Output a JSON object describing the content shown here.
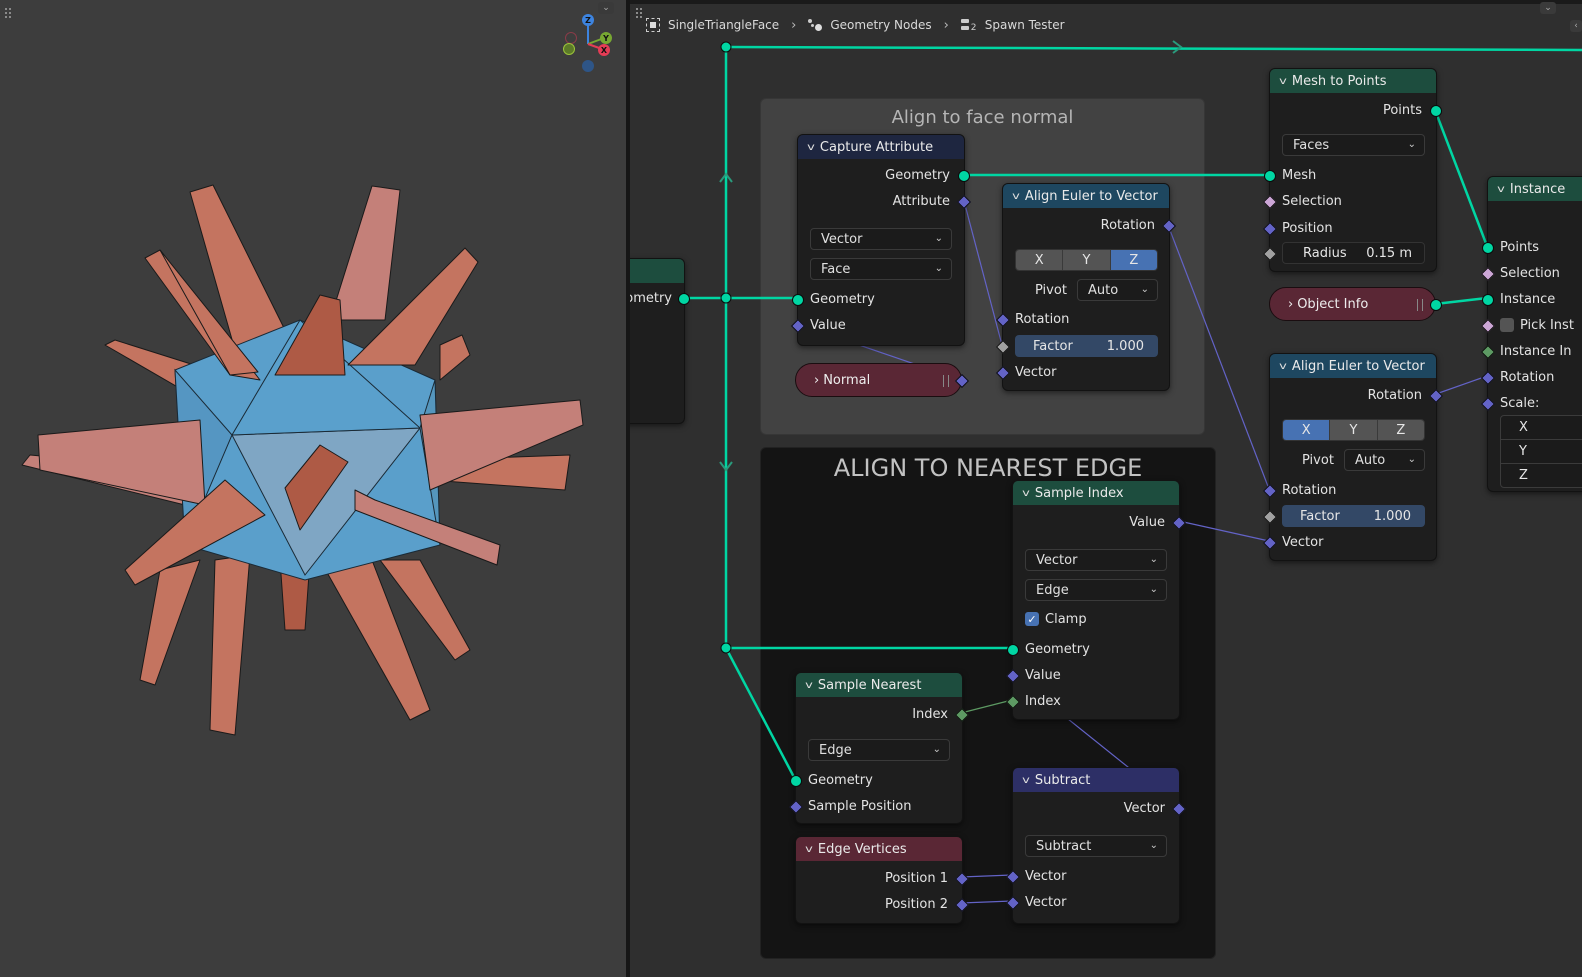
{
  "viewport": {
    "gizmo": {
      "z_label": "Z",
      "y_label": "Y",
      "x_label": "X"
    },
    "colors": {
      "background": "#3d3d3d",
      "mesh": "#5a9fcb",
      "instances": "#c47460"
    }
  },
  "node_editor": {
    "breadcrumb": [
      {
        "icon": "object-icon",
        "label": "SingleTriangleFace"
      },
      {
        "icon": "geometry-nodes-icon",
        "label": "Geometry Nodes"
      },
      {
        "icon": "node-tree-icon",
        "label": "Spawn Tester",
        "badge": "2"
      }
    ],
    "frames": {
      "align_face": {
        "title": "Align to face normal"
      },
      "align_edge": {
        "title": "ALIGN TO NEAREST EDGE"
      }
    },
    "nodes": {
      "group_input": {
        "output": "Geometry",
        "output_visible": "ometry"
      },
      "capture_attribute": {
        "title": "Capture Attribute",
        "outputs": [
          "Geometry",
          "Attribute"
        ],
        "data_type": "Vector",
        "domain": "Face",
        "inputs": [
          "Geometry",
          "Value"
        ]
      },
      "normal": {
        "title": "Normal"
      },
      "align_euler_1": {
        "title": "Align Euler to Vector",
        "output": "Rotation",
        "axis": [
          "X",
          "Y",
          "Z"
        ],
        "axis_selected": "Z",
        "pivot_label": "Pivot",
        "pivot": "Auto",
        "inputs": [
          "Rotation",
          "Vector"
        ],
        "factor_label": "Factor",
        "factor": "1.000"
      },
      "mesh_to_points": {
        "title": "Mesh to Points",
        "output": "Points",
        "mode": "Faces",
        "inputs": [
          "Mesh",
          "Selection",
          "Position"
        ],
        "radius_label": "Radius",
        "radius": "0.15 m"
      },
      "object_info": {
        "title": "Object Info"
      },
      "instance_on_points": {
        "title": "Instance",
        "inputs": [
          "Points",
          "Selection",
          "Instance",
          "Pick Inst",
          "Instance In",
          "Rotation",
          "Scale:"
        ],
        "pick_instance": false,
        "scale_axes": [
          "X",
          "Y",
          "Z"
        ]
      },
      "align_euler_2": {
        "title": "Align Euler to Vector",
        "output": "Rotation",
        "axis": [
          "X",
          "Y",
          "Z"
        ],
        "axis_selected": "X",
        "pivot_label": "Pivot",
        "pivot": "Auto",
        "inputs": [
          "Rotation",
          "Vector"
        ],
        "factor_label": "Factor",
        "factor": "1.000"
      },
      "sample_index": {
        "title": "Sample Index",
        "output": "Value",
        "data_type": "Vector",
        "domain": "Edge",
        "clamp_label": "Clamp",
        "clamp": true,
        "inputs": [
          "Geometry",
          "Value",
          "Index"
        ]
      },
      "sample_nearest": {
        "title": "Sample Nearest",
        "output": "Index",
        "domain": "Edge",
        "inputs": [
          "Geometry",
          "Sample Position"
        ]
      },
      "edge_vertices": {
        "title": "Edge Vertices",
        "outputs": [
          "Position 1",
          "Position 2"
        ]
      },
      "subtract": {
        "title": "Subtract",
        "output": "Vector",
        "operation": "Subtract",
        "inputs": [
          "Vector",
          "Vector"
        ]
      }
    },
    "colors": {
      "geometry_socket": "#00d6a3",
      "vector_socket": "#6363c7",
      "int_socket": "#5d9a63",
      "bool_socket": "#cca6d6",
      "float_socket": "#a1a1a1",
      "header_geometry": "#1d4d3e",
      "header_vector": "#1e4760",
      "header_capture": "#1e2640",
      "header_input": "#5a2735",
      "header_math": "#2d2f66"
    }
  }
}
